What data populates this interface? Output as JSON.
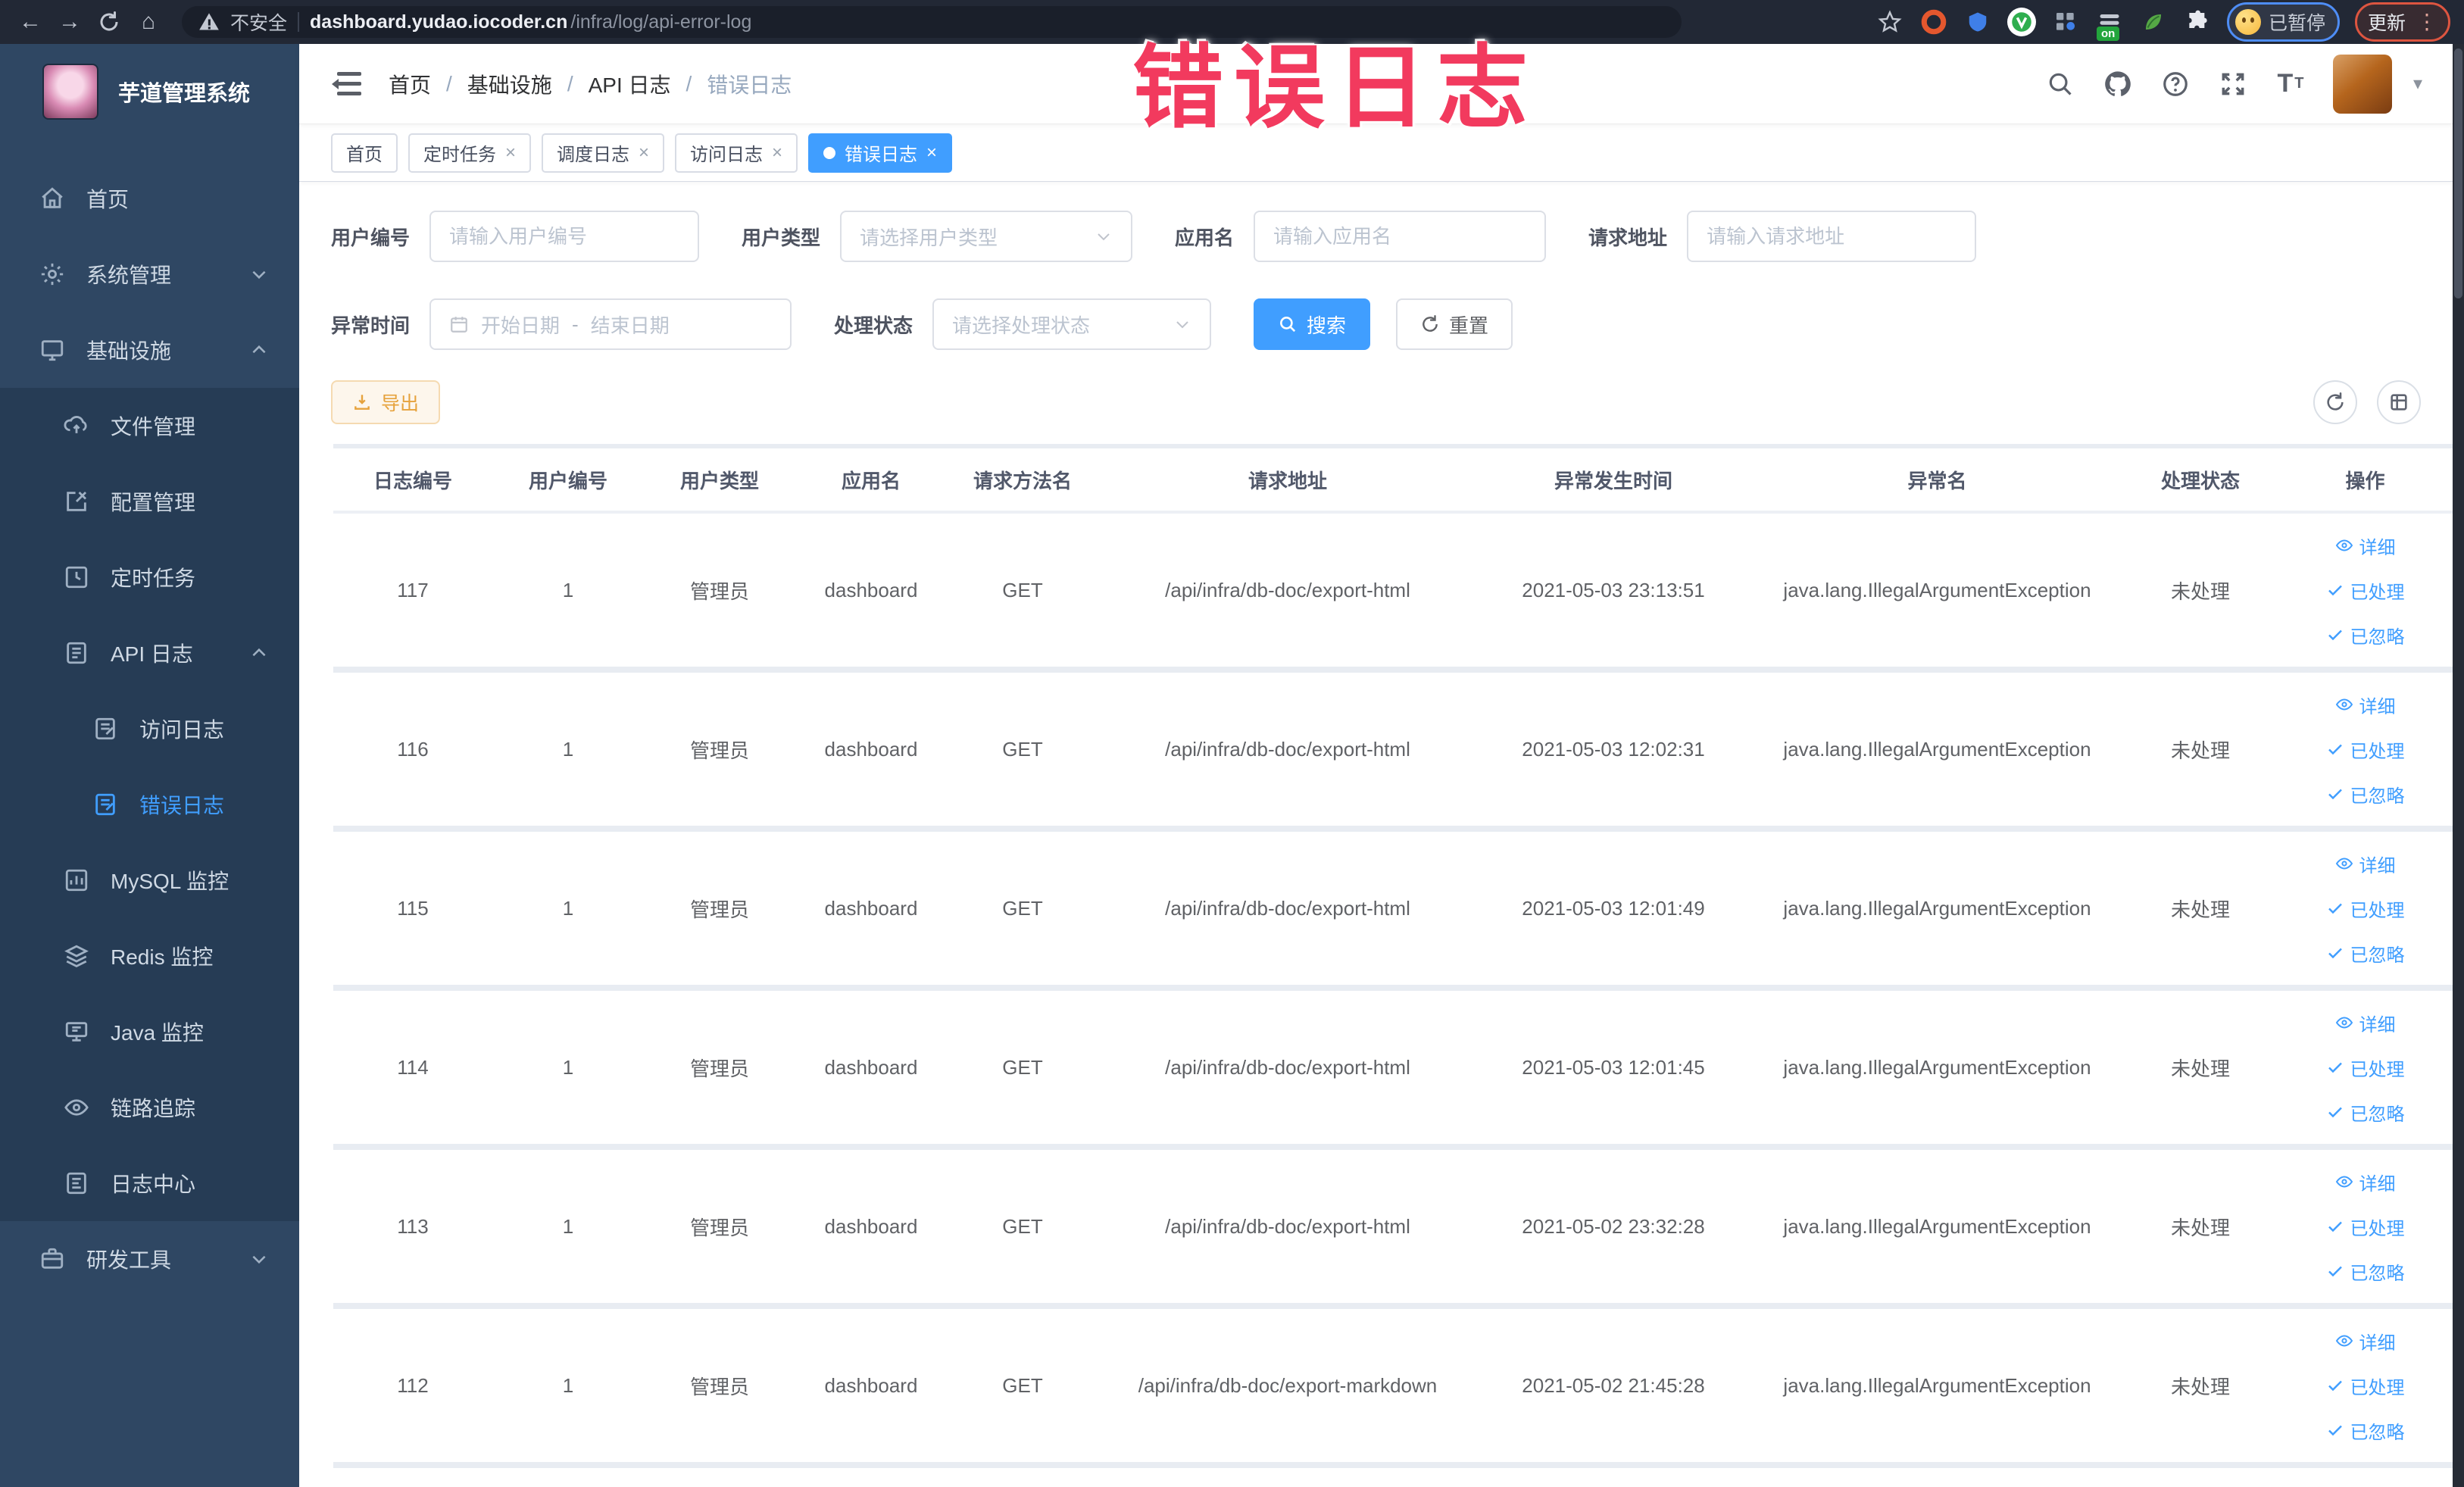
{
  "browser": {
    "security_label": "不安全",
    "url_host": "dashboard.yudao.iocoder.cn",
    "url_path": "/infra/log/api-error-log",
    "ext_on_badge": "on",
    "paused_badge": "已暂停",
    "update_button": "更新",
    "icons": {
      "back": "←",
      "forward": "→",
      "home": "⌂",
      "kebab": "⋮",
      "caret_down": "▾"
    }
  },
  "annotation": {
    "text": "错误日志",
    "color": "#f23a5e"
  },
  "sidebar": {
    "title": "芋道管理系统",
    "items": [
      {
        "label": "首页"
      },
      {
        "label": "系统管理"
      },
      {
        "label": "基础设施"
      },
      {
        "label": "文件管理"
      },
      {
        "label": "配置管理"
      },
      {
        "label": "定时任务"
      },
      {
        "label": "API 日志"
      },
      {
        "label": "访问日志"
      },
      {
        "label": "错误日志"
      },
      {
        "label": "MySQL 监控"
      },
      {
        "label": "Redis 监控"
      },
      {
        "label": "Java 监控"
      },
      {
        "label": "链路追踪"
      },
      {
        "label": "日志中心"
      },
      {
        "label": "研发工具"
      }
    ]
  },
  "breadcrumb": {
    "separator": "/",
    "items": [
      "首页",
      "基础设施",
      "API 日志",
      "错误日志"
    ]
  },
  "tabs": [
    {
      "label": "首页"
    },
    {
      "label": "定时任务"
    },
    {
      "label": "调度日志"
    },
    {
      "label": "访问日志"
    },
    {
      "label": "错误日志"
    }
  ],
  "tab_close_glyph": "×",
  "filters": {
    "user_id": {
      "label": "用户编号",
      "placeholder": "请输入用户编号"
    },
    "user_type": {
      "label": "用户类型",
      "placeholder": "请选择用户类型"
    },
    "app_name": {
      "label": "应用名",
      "placeholder": "请输入应用名"
    },
    "request_url": {
      "label": "请求地址",
      "placeholder": "请输入请求地址"
    },
    "exception_time": {
      "label": "异常时间",
      "start_placeholder": "开始日期",
      "separator": "-",
      "end_placeholder": "结束日期"
    },
    "process_status": {
      "label": "处理状态",
      "placeholder": "请选择处理状态"
    },
    "search_button": "搜索",
    "reset_button": "重置"
  },
  "toolbar": {
    "export_button": "导出"
  },
  "table": {
    "columns": [
      "日志编号",
      "用户编号",
      "用户类型",
      "应用名",
      "请求方法名",
      "请求地址",
      "异常发生时间",
      "异常名",
      "处理状态",
      "操作"
    ],
    "actions": {
      "detail": "详细",
      "processed": "已处理",
      "ignored": "已忽略"
    },
    "rows": [
      {
        "id": "117",
        "user_id": "1",
        "user_type": "管理员",
        "app": "dashboard",
        "method": "GET",
        "url": "/api/infra/db-doc/export-html",
        "time": "2021-05-03 23:13:51",
        "exception": "java.lang.IllegalArgumentException",
        "status": "未处理"
      },
      {
        "id": "116",
        "user_id": "1",
        "user_type": "管理员",
        "app": "dashboard",
        "method": "GET",
        "url": "/api/infra/db-doc/export-html",
        "time": "2021-05-03 12:02:31",
        "exception": "java.lang.IllegalArgumentException",
        "status": "未处理"
      },
      {
        "id": "115",
        "user_id": "1",
        "user_type": "管理员",
        "app": "dashboard",
        "method": "GET",
        "url": "/api/infra/db-doc/export-html",
        "time": "2021-05-03 12:01:49",
        "exception": "java.lang.IllegalArgumentException",
        "status": "未处理"
      },
      {
        "id": "114",
        "user_id": "1",
        "user_type": "管理员",
        "app": "dashboard",
        "method": "GET",
        "url": "/api/infra/db-doc/export-html",
        "time": "2021-05-03 12:01:45",
        "exception": "java.lang.IllegalArgumentException",
        "status": "未处理"
      },
      {
        "id": "113",
        "user_id": "1",
        "user_type": "管理员",
        "app": "dashboard",
        "method": "GET",
        "url": "/api/infra/db-doc/export-html",
        "time": "2021-05-02 23:32:28",
        "exception": "java.lang.IllegalArgumentException",
        "status": "未处理"
      },
      {
        "id": "112",
        "user_id": "1",
        "user_type": "管理员",
        "app": "dashboard",
        "method": "GET",
        "url": "/api/infra/db-doc/export-markdown",
        "time": "2021-05-02 21:45:28",
        "exception": "java.lang.IllegalArgumentException",
        "status": "未处理"
      }
    ]
  },
  "colors": {
    "accent": "#409eff",
    "sidebar_bg": "#2f4763",
    "submenu_bg": "#263c55",
    "warning": "#e6a23c",
    "annotation": "#f23a5e"
  }
}
